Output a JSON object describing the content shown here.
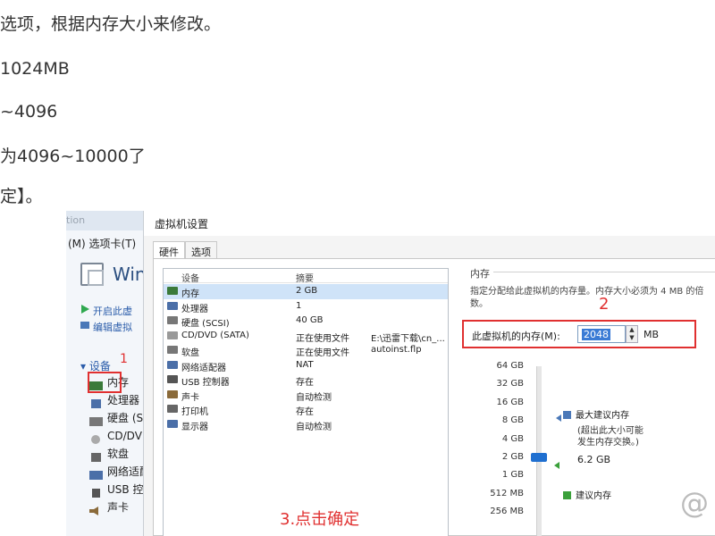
{
  "article": {
    "lines": [
      "选项，根据内存大小来修改。",
      "1024MB",
      "~4096",
      "为4096~10000了",
      "定】。"
    ]
  },
  "bg_window": {
    "title_fragment": "tion",
    "menu": "(M)  选项卡(T)",
    "vm_name": "Wind",
    "actions": [
      "开启此虚",
      "编辑虚拟"
    ],
    "devices_header": "设备",
    "devices": [
      "内存",
      "处理器",
      "硬盘 (SC",
      "CD/DVI",
      "软盘",
      "网络适配",
      "USB 控制",
      "声卡"
    ],
    "step_label": "1"
  },
  "dialog": {
    "title": "虚拟机设置",
    "tabs": [
      "硬件",
      "选项"
    ],
    "device_col": "设备",
    "summary_col": "摘要",
    "devices": [
      {
        "name": "内存",
        "summary": "2 GB",
        "summary2": "",
        "icon": "memory-icon",
        "color": "#3a7a3a",
        "selected": true
      },
      {
        "name": "处理器",
        "summary": "1",
        "summary2": "",
        "icon": "processor-icon",
        "color": "#4b6fa8",
        "selected": false
      },
      {
        "name": "硬盘 (SCSI)",
        "summary": "40 GB",
        "summary2": "",
        "icon": "hard-disk-icon",
        "color": "#777777",
        "selected": false
      },
      {
        "name": "CD/DVD (SATA)",
        "summary": "正在使用文件",
        "summary2": "E:\\迅雷下载\\cn_...",
        "icon": "cd-dvd-icon",
        "color": "#999999",
        "selected": false
      },
      {
        "name": "软盘",
        "summary": "正在使用文件",
        "summary2": "autoinst.flp",
        "icon": "floppy-icon",
        "color": "#777777",
        "selected": false
      },
      {
        "name": "网络适配器",
        "summary": "NAT",
        "summary2": "",
        "icon": "network-adapter-icon",
        "color": "#4b6fa8",
        "selected": false
      },
      {
        "name": "USB 控制器",
        "summary": "存在",
        "summary2": "",
        "icon": "usb-icon",
        "color": "#555555",
        "selected": false
      },
      {
        "name": "声卡",
        "summary": "自动检测",
        "summary2": "",
        "icon": "sound-card-icon",
        "color": "#8a6a3a",
        "selected": false
      },
      {
        "name": "打印机",
        "summary": "存在",
        "summary2": "",
        "icon": "printer-icon",
        "color": "#666666",
        "selected": false
      },
      {
        "name": "显示器",
        "summary": "自动检测",
        "summary2": "",
        "icon": "display-icon",
        "color": "#4b6fa8",
        "selected": false
      }
    ],
    "step3_label": "3.点击确定",
    "memory": {
      "group_title": "内存",
      "description": "指定分配给此虚拟机的内存量。内存大小必须为 4 MB 的倍数。",
      "step_label": "2",
      "field_label": "此虚拟机的内存(M):",
      "value": "2048",
      "unit": "MB",
      "scale_ticks": [
        "64 GB",
        "32 GB",
        "16 GB",
        "8 GB",
        "4 GB",
        "2 GB",
        "1 GB",
        "512 MB",
        "256 MB"
      ],
      "max_recommended_label": "最大建议内存",
      "max_recommended_note_1": "(超出此大小可能",
      "max_recommended_note_2": "发生内存交换。)",
      "max_recommended_value": "6.2 GB",
      "recommended_label": "建议内存",
      "slider_value": "2 GB"
    }
  },
  "colors": {
    "red_annotation": "#e03030",
    "slider_thumb": "#1f6fd0",
    "max_marker": "#4a78b8",
    "rec_marker": "#3aa03a"
  }
}
